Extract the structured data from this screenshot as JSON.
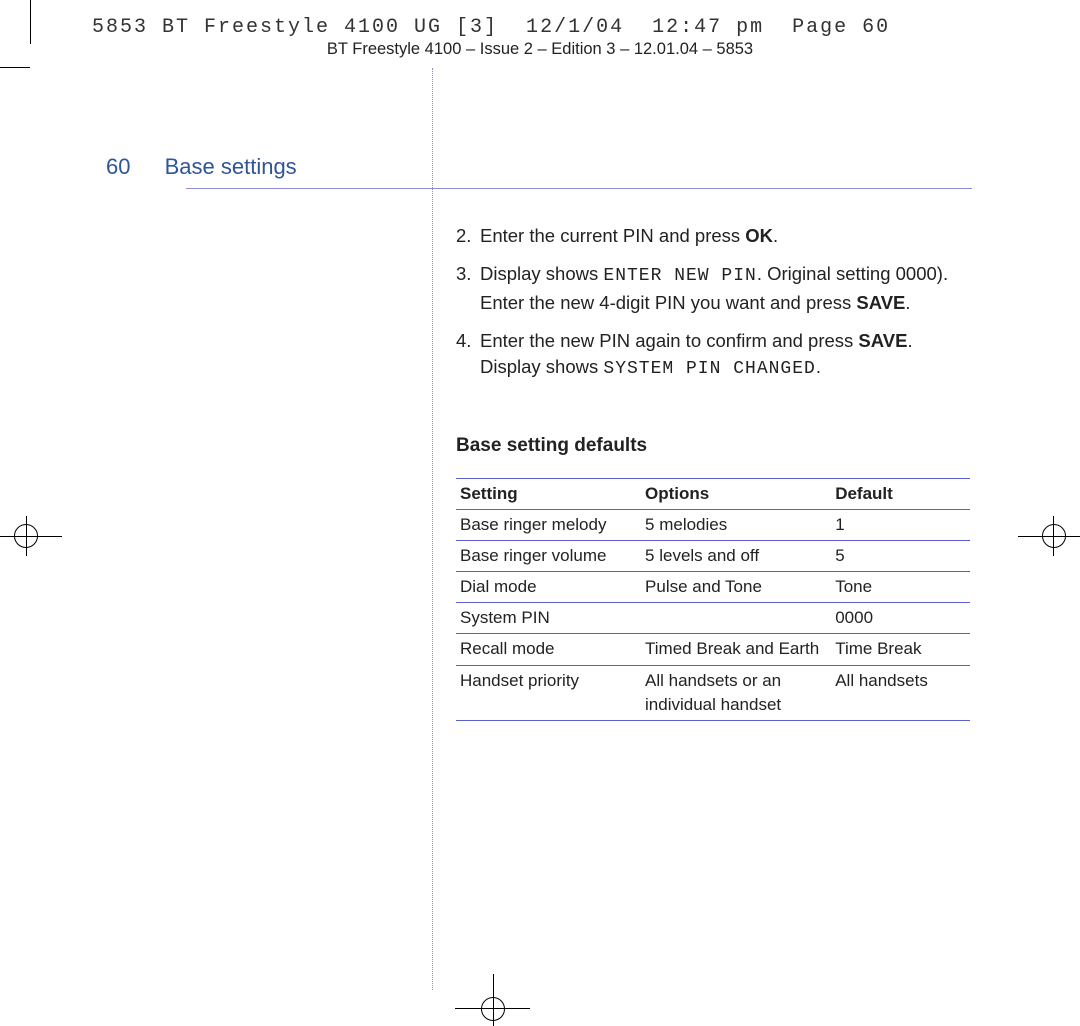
{
  "slug_line": "5853 BT Freestyle 4100 UG [3]  12/1/04  12:47 pm  Page 60",
  "issue_line": "BT Freestyle 4100 – Issue 2 – Edition 3 – 12.01.04 – 5853",
  "page_number": "60",
  "section_title": "Base settings",
  "steps": {
    "s2_num": "2.",
    "s2_a": "Enter the current PIN and press ",
    "s2_b_bold": "OK",
    "s2_c": ".",
    "s3_num": "3.",
    "s3_a": "Display shows ",
    "s3_b_lcd": "ENTER NEW PIN",
    "s3_c": ". Original setting 0000). Enter the new 4-digit PIN you want and press ",
    "s3_d_bold": "SAVE",
    "s3_e": ".",
    "s4_num": "4.",
    "s4_a": "Enter the new PIN again to confirm and press ",
    "s4_b_bold": "SAVE",
    "s4_c": ". Display shows ",
    "s4_d_lcd": "SYSTEM PIN CHANGED",
    "s4_e": "."
  },
  "defaults_heading": "Base setting defaults",
  "table": {
    "headers": {
      "setting": "Setting",
      "options": "Options",
      "default": "Default"
    },
    "rows": [
      {
        "setting": "Base ringer melody",
        "options": "5 melodies",
        "default": "1"
      },
      {
        "setting": "Base ringer volume",
        "options": "5 levels and off",
        "default": "5"
      },
      {
        "setting": "Dial mode",
        "options": "Pulse and Tone",
        "default": "Tone"
      },
      {
        "setting": "System PIN",
        "options": "",
        "default": "0000"
      },
      {
        "setting": "Recall mode",
        "options": "Timed Break and Earth",
        "default": "Time Break"
      },
      {
        "setting": "Handset priority",
        "options": "All handsets or an individual handset",
        "default": "All handsets"
      }
    ]
  }
}
